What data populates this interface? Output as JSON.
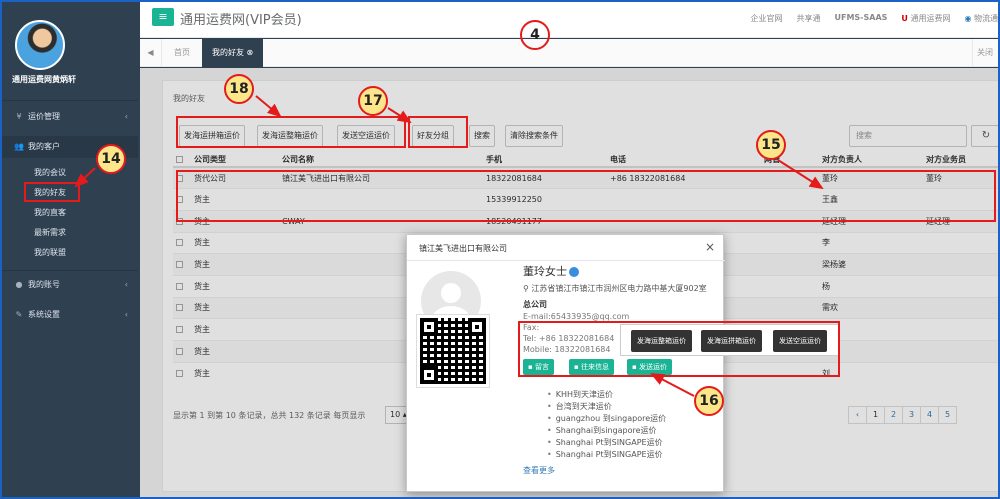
{
  "sidebar": {
    "profile_name": "通用运费网黄炳轩",
    "items": [
      {
        "label": "运价管理",
        "icon": "yen-icon",
        "chevron": "‹"
      },
      {
        "label": "我的客户",
        "icon": "users-icon"
      },
      {
        "label": "我的账号",
        "icon": "user-icon",
        "chevron": "‹"
      },
      {
        "label": "系统设置",
        "icon": "wrench-icon",
        "chevron": "‹"
      }
    ],
    "subitems": [
      "我的会议",
      "我的好友",
      "我的直客",
      "最新需求",
      "我的联盟"
    ]
  },
  "header": {
    "title": "通用运费网(VIP会员)",
    "links": [
      "企业官网",
      "共享通",
      "UFMS-SAAS",
      "通用运费网",
      "物流通"
    ]
  },
  "tabs": {
    "home": "首页",
    "active": "我的好友",
    "right": "关闭"
  },
  "panel": {
    "title": "我的好友",
    "toolbar": [
      "发海运拼箱运价",
      "发海运整箱运价",
      "发送空运运价",
      "好友分组",
      "搜索",
      "清除搜索条件"
    ],
    "search_placeholder": "搜索"
  },
  "table": {
    "columns": [
      "公司类型",
      "公司名称",
      "手机",
      "电话",
      "网管",
      "对方负责人",
      "对方业务员"
    ],
    "rows": [
      [
        "货代公司",
        "镇江美飞进出口有限公司",
        "18322081684",
        "+86 18322081684",
        "",
        "董玲",
        "董玲"
      ],
      [
        "货主",
        "",
        "15339912250",
        "",
        "",
        "王鑫",
        ""
      ],
      [
        "货主",
        "CWAY",
        "18520491177",
        "",
        "",
        "延经理",
        "延经理"
      ],
      [
        "货主",
        "",
        "",
        "",
        "",
        "李",
        ""
      ],
      [
        "货主",
        "",
        "",
        "",
        "",
        "梁杨婆",
        ""
      ],
      [
        "货主",
        "",
        "",
        "",
        "",
        "杨",
        ""
      ],
      [
        "货主",
        "",
        "",
        "",
        "",
        "需欢",
        ""
      ],
      [
        "货主",
        "",
        "",
        "",
        "",
        "",
        ""
      ],
      [
        "货主",
        "",
        "",
        "",
        "",
        "宋",
        ""
      ],
      [
        "货主",
        "",
        "",
        "",
        "",
        "刘",
        ""
      ]
    ]
  },
  "pagination": {
    "info": "显示第 1 到第 10 条记录，总共 132 条记录 每页显示",
    "page_size": "10",
    "pages": [
      "‹",
      "1",
      "2",
      "3",
      "4",
      "5"
    ]
  },
  "modal": {
    "title": "镇江美飞进出口有限公司",
    "close": "×",
    "name": "董玲女士",
    "address": "江苏省镇江市镇江市润州区电力路中基大厦902室",
    "company_label": "总公司",
    "email": "E-mail:65433935@qq.com",
    "fax": "Fax:",
    "tel": "Tel: +86 18322081684",
    "mobile": "Mobile: 18322081684",
    "buttons": [
      "留言",
      "往来信息",
      "发送运价"
    ],
    "routes": [
      "KHH到天津运价",
      "台湾到天津运价",
      "guangzhou 到singapore运价",
      "Shanghai到singapore运价",
      "Shanghai Pt到SINGAPE运价",
      "Shanghai Pt到SINGAPE运价"
    ],
    "more": "查看更多"
  },
  "popover": {
    "buttons": [
      "发海运整箱运价",
      "发海运拼箱运价",
      "发送空运运价"
    ]
  },
  "annotations": [
    "4",
    "14",
    "15",
    "16",
    "17",
    "18"
  ],
  "colors": {
    "accent": "#1ab394",
    "sidebar": "#2f4050",
    "callout": "#e31b1b",
    "link": "#337ab7"
  }
}
